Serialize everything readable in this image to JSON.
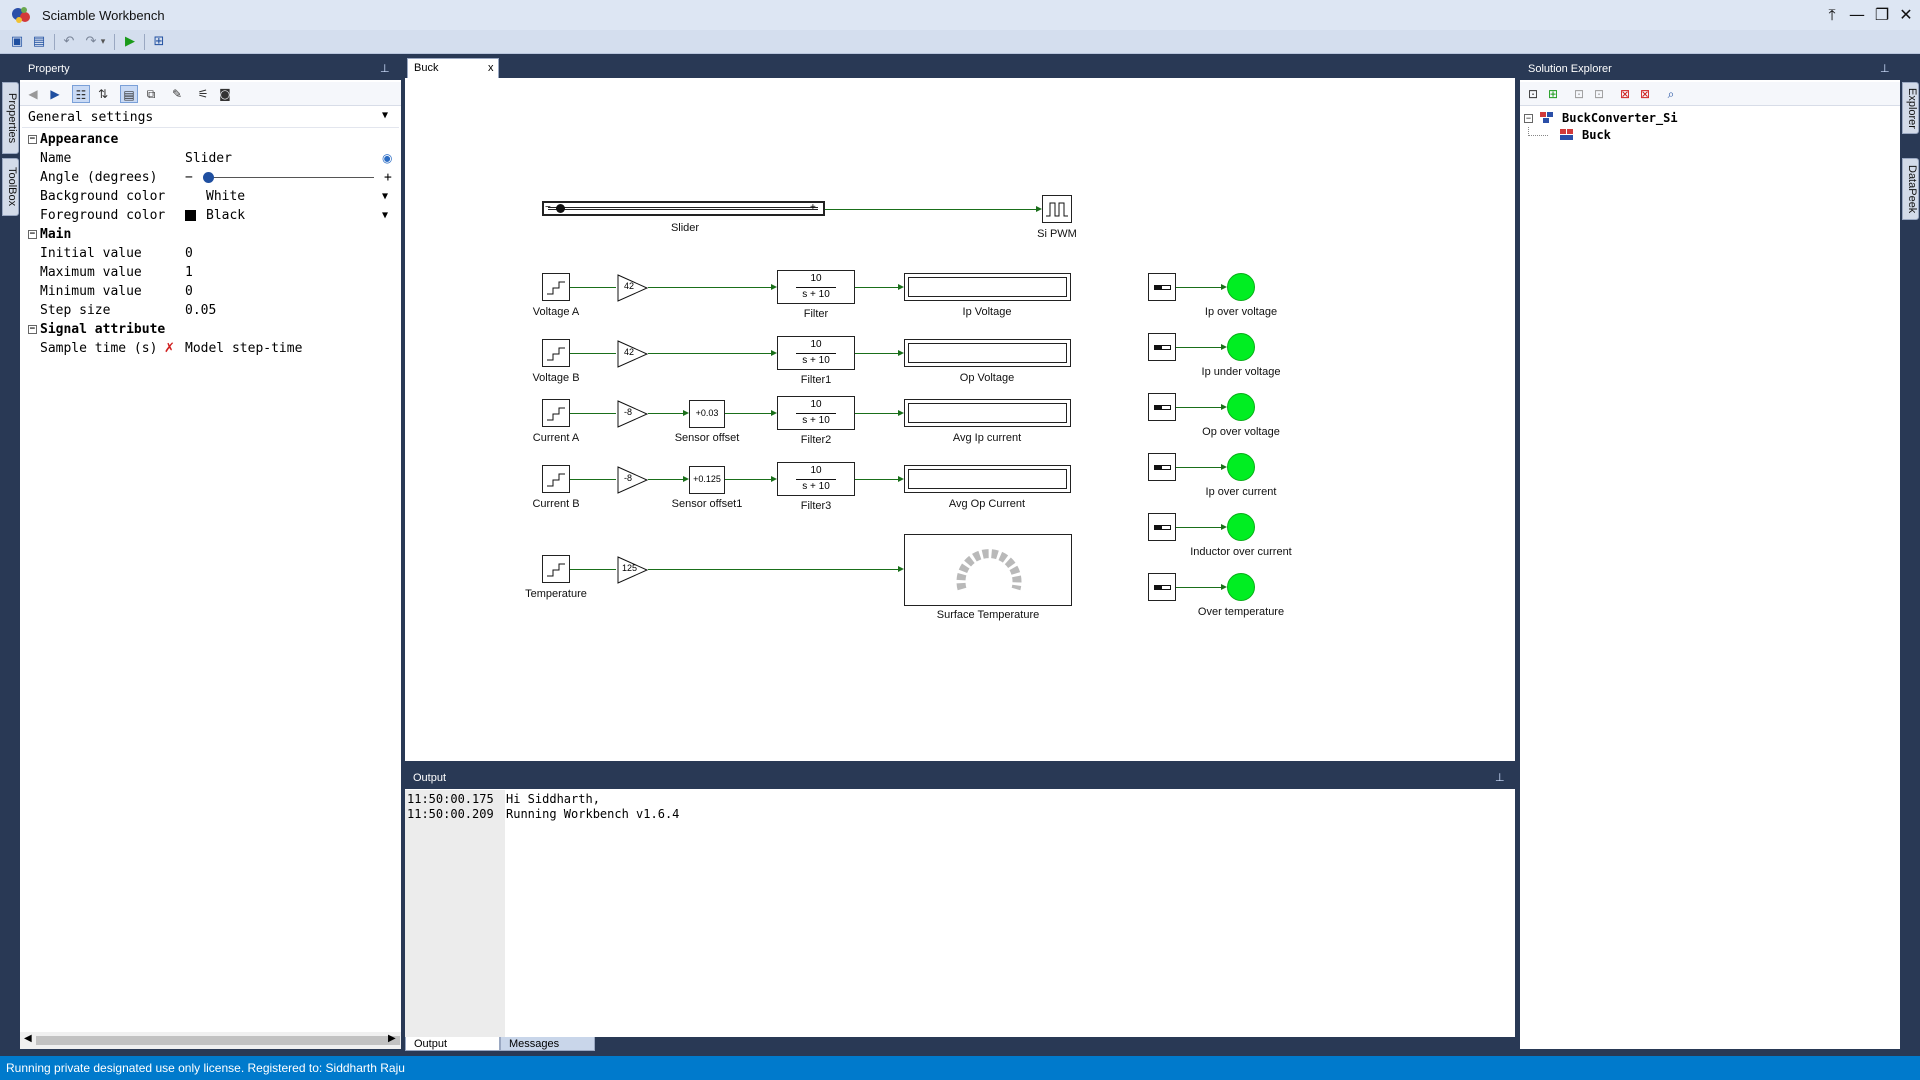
{
  "window": {
    "title": "Sciamble Workbench"
  },
  "side_tabs": {
    "left": [
      "Properties",
      "ToolBox"
    ],
    "right": [
      "Explorer",
      "DataPeek"
    ]
  },
  "property_panel": {
    "title": "Property",
    "dropdown": "General settings",
    "categories": {
      "appearance": "Appearance",
      "main": "Main",
      "signal": "Signal attribute"
    },
    "rows": {
      "name": {
        "label": "Name",
        "value": "Slider"
      },
      "angle": {
        "label": "Angle (degrees)",
        "value": 0,
        "minus": "−",
        "plus": "+"
      },
      "bg": {
        "label": "Background color",
        "value": "White"
      },
      "fg": {
        "label": "Foreground color",
        "value": "Black"
      },
      "initial": {
        "label": "Initial value",
        "value": "0"
      },
      "max": {
        "label": "Maximum value",
        "value": "1"
      },
      "min": {
        "label": "Minimum value",
        "value": "0"
      },
      "step": {
        "label": "Step size",
        "value": "0.05"
      },
      "sample": {
        "label": "Sample time (s)",
        "value": "Model step-time"
      }
    }
  },
  "editor": {
    "tab": "Buck",
    "tab_close": "x",
    "blocks": {
      "slider": "Slider",
      "pwm": "Si PWM",
      "voltage_a": "Voltage A",
      "voltage_b": "Voltage B",
      "current_a": "Current A",
      "current_b": "Current B",
      "temperature": "Temperature",
      "gain_1": "42",
      "gain_2": "42",
      "gain_3": "-8",
      "gain_4": "-8",
      "gain_5": "125",
      "sensor_offset": "Sensor offset",
      "sensor_offset1": "Sensor offset1",
      "offset_val_1": "+0.03",
      "offset_val_2": "+0.125",
      "filter": "Filter",
      "filter1": "Filter1",
      "filter2": "Filter2",
      "filter3": "Filter3",
      "num": "10",
      "den": "s + 10",
      "ip_voltage": "Ip Voltage",
      "op_voltage": "Op Voltage",
      "avg_ip_current": "Avg Ip current",
      "avg_op_current": "Avg Op Current",
      "surface_temperature": "Surface Temperature",
      "led_ip_over_voltage": "Ip over voltage",
      "led_ip_under_voltage": "Ip under voltage",
      "led_op_over_voltage": "Op over voltage",
      "led_ip_over_current": "Ip over current",
      "led_inductor_over_current": "Inductor over current",
      "led_over_temperature": "Over temperature"
    },
    "colors": {
      "wire": "#1a6f1a",
      "led": "#00ee22"
    }
  },
  "output": {
    "title": "Output",
    "lines": [
      {
        "time": "11:50:00.175",
        "text": "Hi Siddharth,"
      },
      {
        "time": "11:50:00.209",
        "text": "Running Workbench v1.6.4"
      }
    ],
    "tabs": [
      "Output",
      "Messages"
    ]
  },
  "solution_explorer": {
    "title": "Solution Explorer",
    "root": "BuckConverter_Si",
    "child": "Buck"
  },
  "status": {
    "text": "Running private designated use only license. Registered to: Siddharth Raju"
  }
}
